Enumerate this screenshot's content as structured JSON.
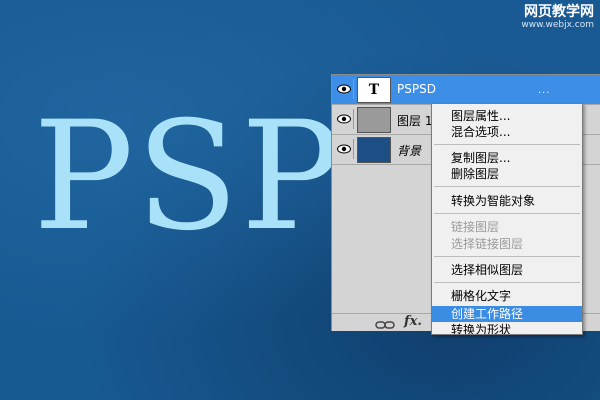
{
  "canvas": {
    "big_text": "PSP"
  },
  "watermark": {
    "line1": "网页教学网",
    "line2": "www.webjx.com"
  },
  "layers": [
    {
      "name": "PSPSD",
      "thumb": "T",
      "type": "text",
      "selected": true,
      "more": "..."
    },
    {
      "name": "图层 1",
      "type": "gray",
      "selected": false
    },
    {
      "name": "背景",
      "type": "background",
      "selected": false
    }
  ],
  "panel_footer": {
    "link_icon": "link-icon",
    "fx_label": "fx."
  },
  "context_menu": {
    "items": [
      {
        "label": "图层属性...",
        "disabled": false
      },
      {
        "label": "混合选项...",
        "disabled": false
      },
      {
        "label": "复制图层...",
        "disabled": false
      },
      {
        "label": "删除图层",
        "disabled": false
      },
      {
        "label": "转换为智能对象",
        "disabled": false
      },
      {
        "label": "链接图层",
        "disabled": true
      },
      {
        "label": "选择链接图层",
        "disabled": true
      },
      {
        "label": "选择相似图层",
        "disabled": false
      },
      {
        "label": "栅格化文字",
        "disabled": false
      },
      {
        "label": "创建工作路径",
        "disabled": false,
        "highlighted": true
      },
      {
        "label": "转换为形状",
        "disabled": false
      }
    ]
  },
  "colors": {
    "canvas_bg": "#175a92",
    "big_text": "#a9e2f8",
    "selection": "#3b8de4"
  }
}
